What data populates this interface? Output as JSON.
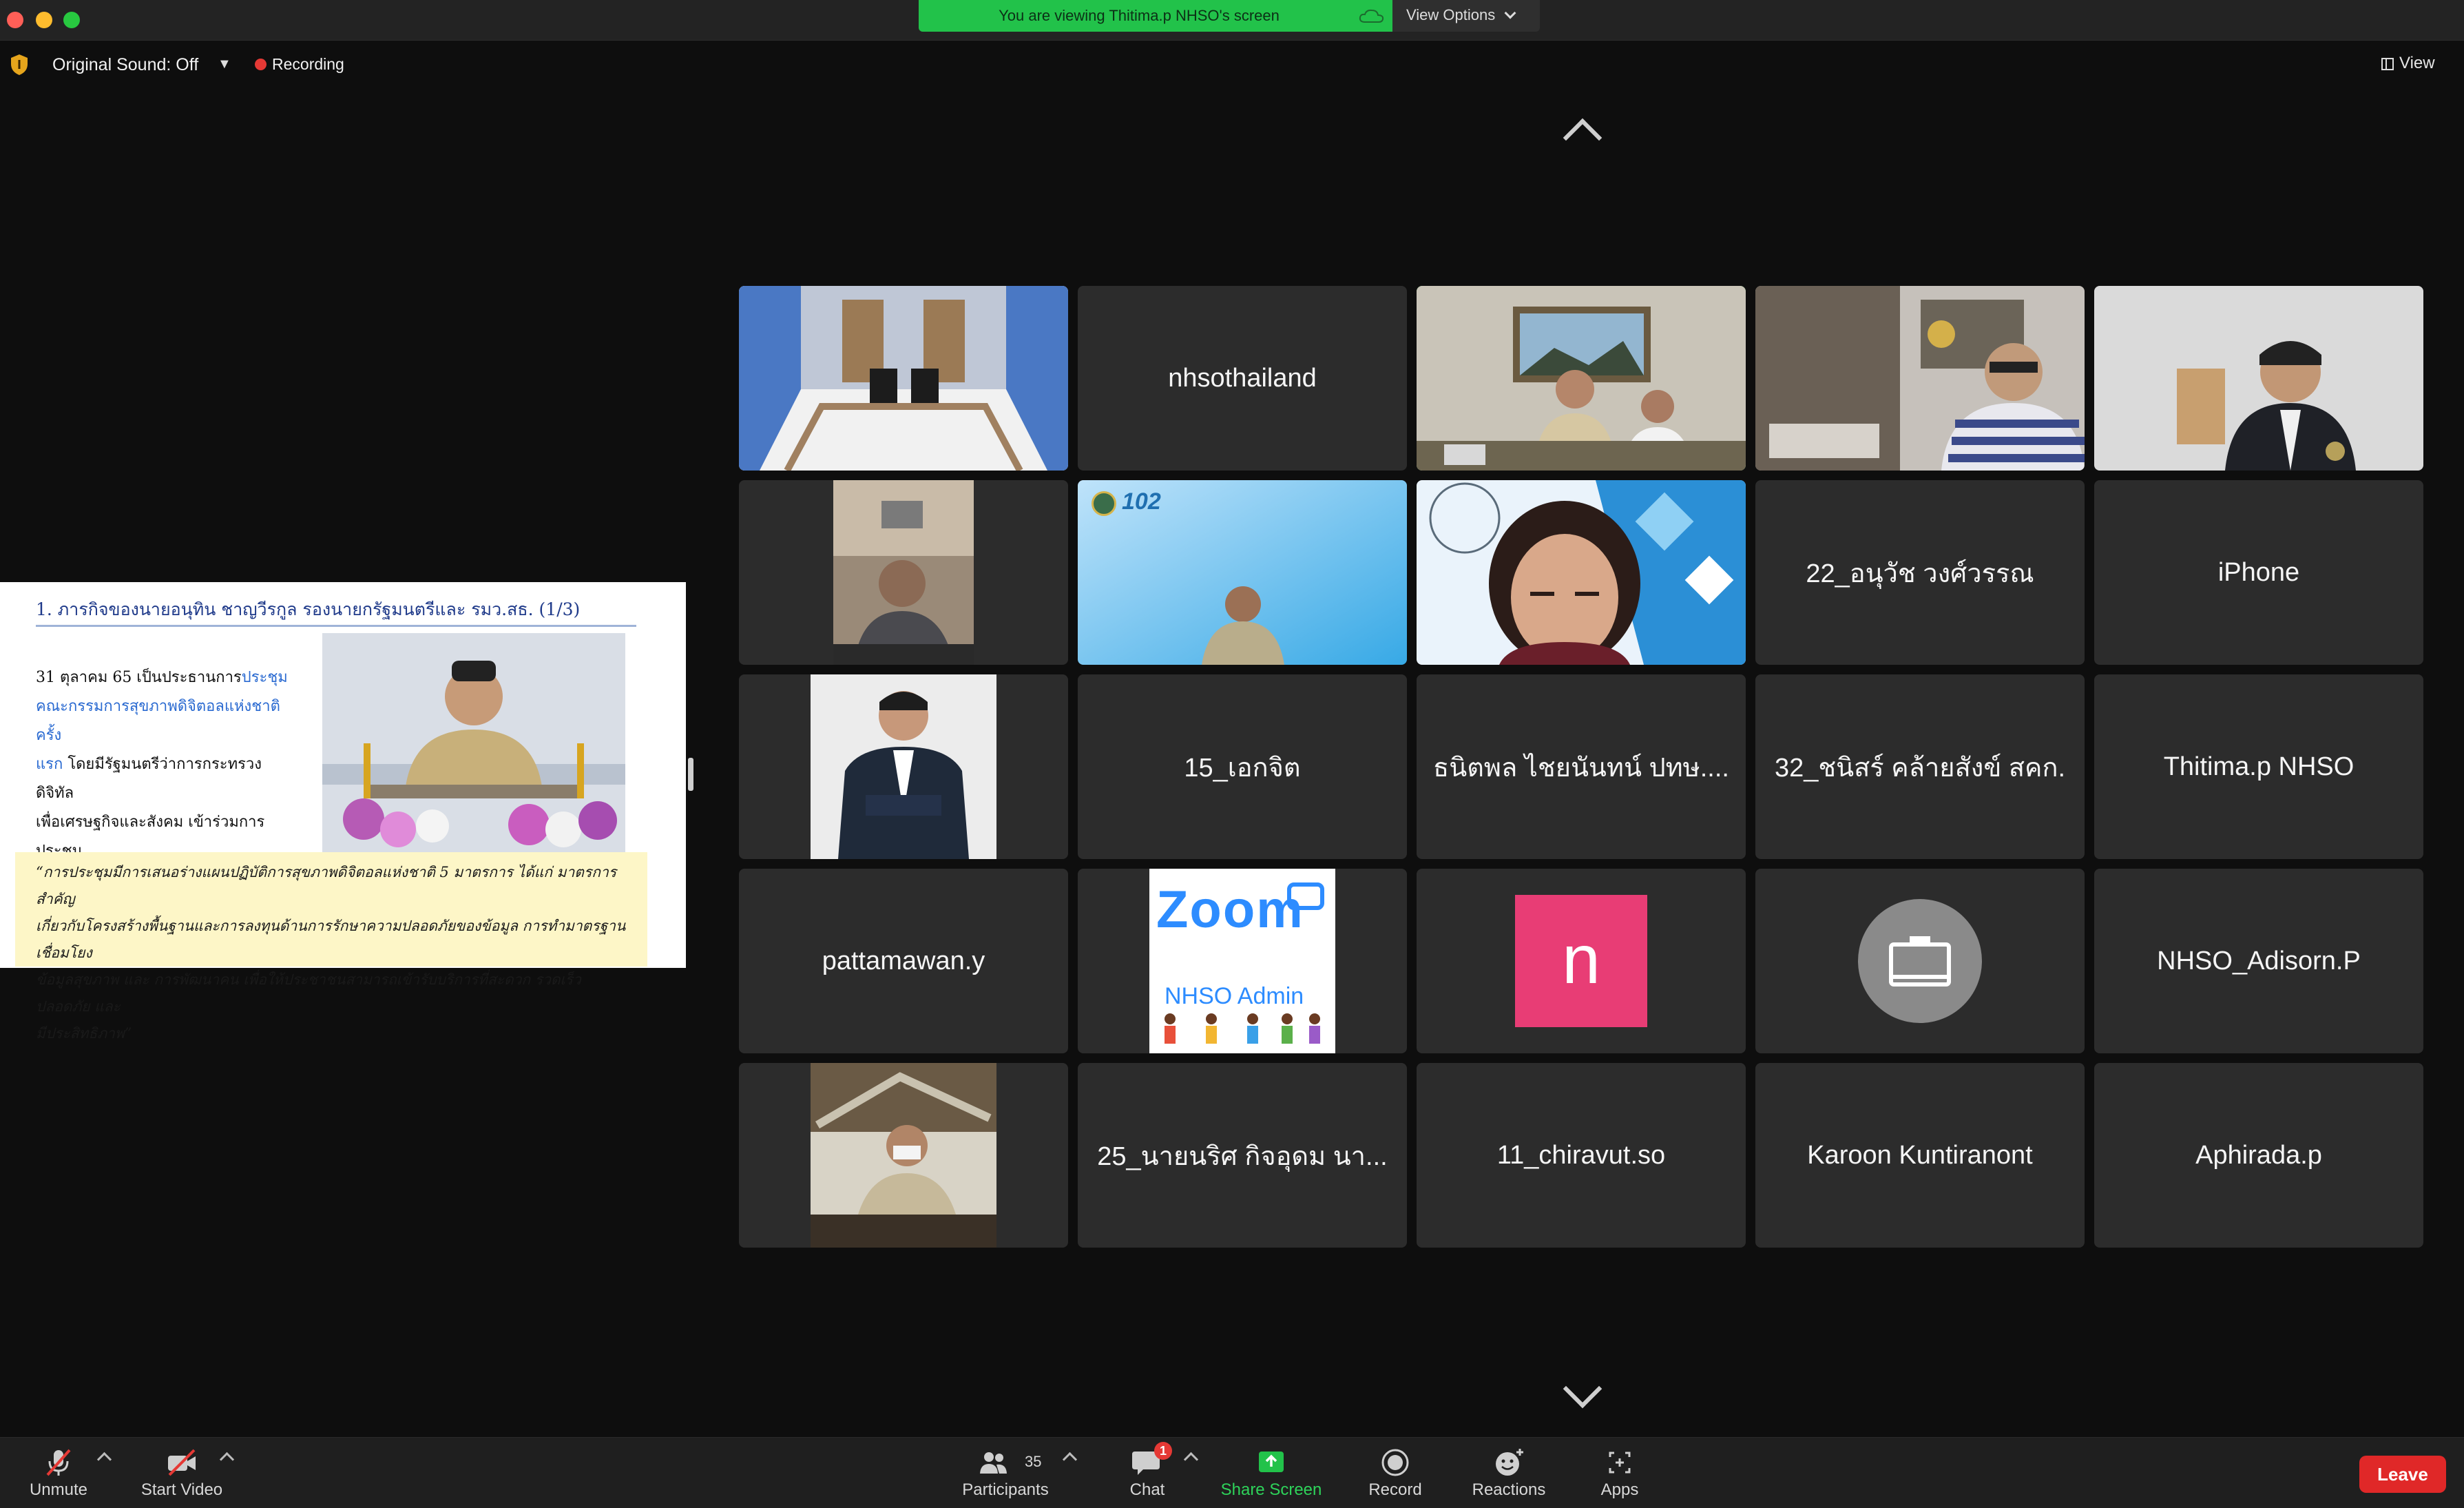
{
  "window": {
    "viewing_banner": "You are viewing Thitima.p NHSO's screen",
    "view_options": "View Options"
  },
  "status": {
    "original_sound": "Original Sound: Off",
    "recording": "Recording",
    "view": "View"
  },
  "shared_slide": {
    "title": "1. ภารกิจของนายอนุทิน ชาญวีรกูล รองนายกรัฐมนตรีและ รมว.สธ. (1/3)",
    "body_lines": [
      "31 ตุลาคม 65  เป็นประธานการ",
      "ประชุม",
      "คณะกรรมการสุขภาพดิจิตอลแห่งชาติครั้ง",
      "แรก",
      "โดยมีรัฐมนตรีว่าการกระทรวงดิจิทัล",
      "เพื่อเศรษฐกิจและสังคม เข้าร่วมการ",
      "ประชุม"
    ],
    "quote_lines": [
      "“การประชุมมีการเสนอร่างแผนปฏิบัติการสุขภาพดิจิตอลแห่งชาติ 5 มาตรการ ได้แก่ มาตรการสำคัญ",
      "เกี่ยวกับโครงสร้างพื้นฐานและการลงทุนด้านการรักษาความปลอดภัยของข้อมูล การทำมาตรฐานเชื่อมโยง",
      "ข้อมูลสุขภาพ และ การพัฒนาคน เพื่อให้ประชาชนสามารถเข้ารับบริการที่สะดวก รวดเร็ว ปลอดภัย และ",
      "มีประสิทธิภาพ”"
    ]
  },
  "gallery": {
    "tiles": [
      {
        "name": "nhsothailand"
      },
      {
        "name": "22_อนุวัช วงศ์วรรณ"
      },
      {
        "name": "iPhone"
      },
      {
        "name": "15_เอกจิต"
      },
      {
        "name": "ธนิตพล ไชยนันทน์ ปทษ...."
      },
      {
        "name": "32_ชนิสร์ คล้ายสังข์ สคก."
      },
      {
        "name": "Thitima.p NHSO"
      },
      {
        "name": "pattamawan.y"
      },
      {
        "name": "NHSO_Adisorn.P"
      },
      {
        "name": "25_นายนริศ กิจอุดม นา..."
      },
      {
        "name": "11_chiravut.so"
      },
      {
        "name": "Karoon Kuntiranont"
      },
      {
        "name": "Aphirada.p"
      }
    ],
    "avatar_letter": "n",
    "zoom_logo_word": "Zoom",
    "zoom_logo_sub": "NHSO Admin",
    "org_logo_text": "102"
  },
  "toolbar": {
    "unmute": "Unmute",
    "start_video": "Start Video",
    "participants": "Participants",
    "participants_count": "35",
    "chat": "Chat",
    "chat_badge": "1",
    "share_screen": "Share Screen",
    "record": "Record",
    "reactions": "Reactions",
    "apps": "Apps",
    "leave": "Leave"
  },
  "colors": {
    "accent_green": "#22c24a",
    "active_speaker": "#2ecc40",
    "leave_red": "#e02828",
    "avatar_pink": "#e83d75"
  }
}
